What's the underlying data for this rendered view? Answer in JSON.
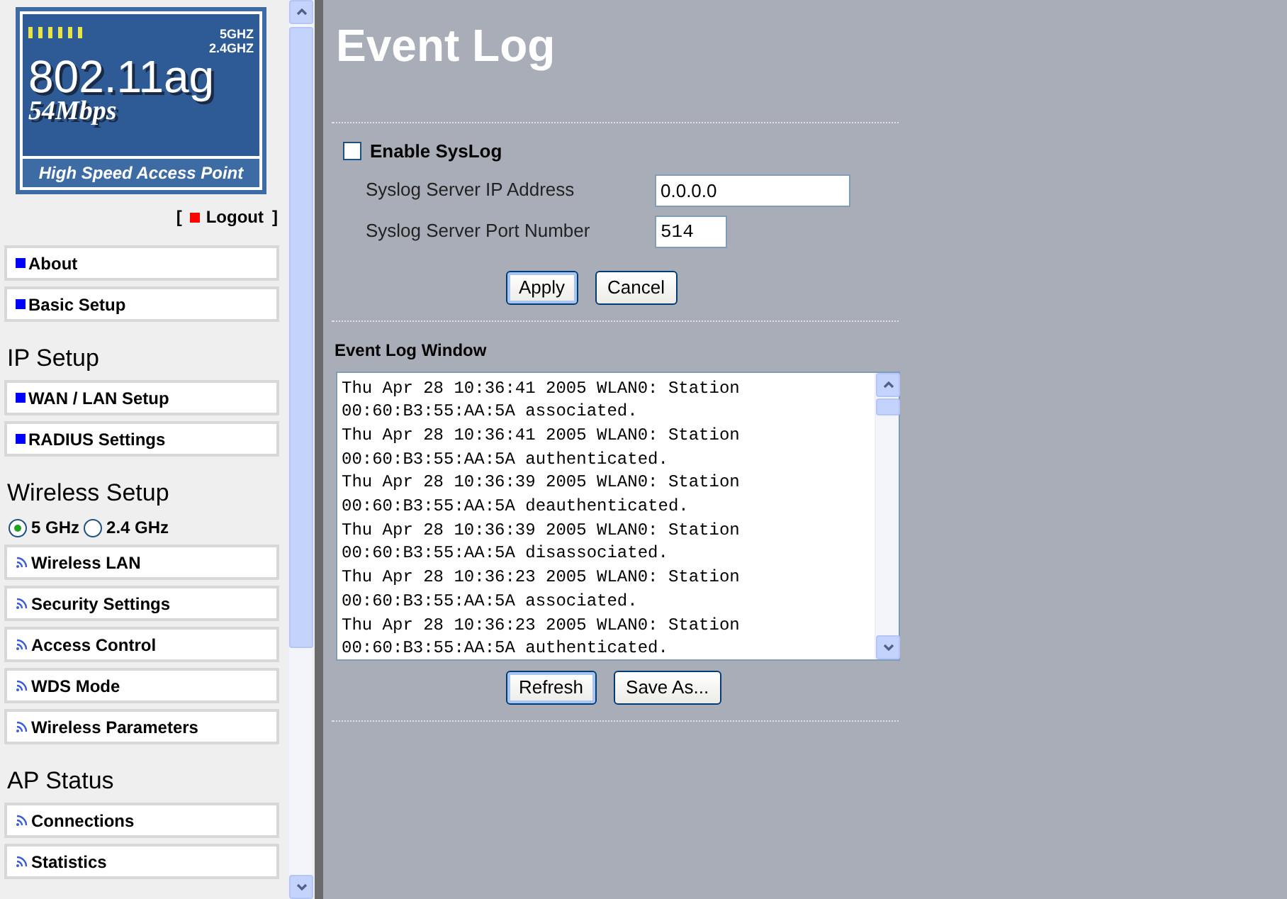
{
  "logo": {
    "bands": [
      "5GHZ",
      "2.4GHZ"
    ],
    "standard": "802.11ag",
    "speed": "54Mbps",
    "tagline": "High Speed Access Point"
  },
  "logout": {
    "open": "[",
    "label": "Logout",
    "close": "]"
  },
  "sidebar": {
    "sections": [
      {
        "items": [
          {
            "label": "About",
            "kind": "square"
          },
          {
            "label": "Basic Setup",
            "kind": "square"
          }
        ]
      },
      {
        "heading": "IP Setup",
        "items": [
          {
            "label": "WAN / LAN Setup",
            "kind": "square"
          },
          {
            "label": "RADIUS Settings",
            "kind": "square"
          }
        ]
      },
      {
        "heading": "Wireless Setup",
        "radios": [
          {
            "label": "5 GHz",
            "selected": true
          },
          {
            "label": "2.4 GHz",
            "selected": false
          }
        ],
        "items": [
          {
            "label": "Wireless LAN",
            "kind": "wifi"
          },
          {
            "label": "Security Settings",
            "kind": "wifi"
          },
          {
            "label": "Access Control",
            "kind": "wifi"
          },
          {
            "label": "WDS Mode",
            "kind": "wifi"
          },
          {
            "label": "Wireless Parameters",
            "kind": "wifi"
          }
        ]
      },
      {
        "heading": "AP Status",
        "items": [
          {
            "label": "Connections",
            "kind": "wifi"
          },
          {
            "label": "Statistics",
            "kind": "wifi"
          }
        ]
      }
    ]
  },
  "page_title": "Event Log",
  "syslog": {
    "enable": {
      "label": "Enable SysLog",
      "checked": false
    },
    "fields": [
      {
        "label": "Syslog Server IP Address",
        "value": "0.0.0.0",
        "kind": "wide"
      },
      {
        "label": "Syslog Server Port Number",
        "value": "514",
        "kind": "narrow"
      }
    ],
    "buttons": [
      {
        "label": "Apply",
        "focused": true
      },
      {
        "label": "Cancel",
        "focused": false
      }
    ]
  },
  "event_log": {
    "title": "Event Log Window",
    "lines": [
      "Thu Apr 28 10:36:41 2005 WLAN0: Station",
      "00:60:B3:55:AA:5A associated.",
      "Thu Apr 28 10:36:41 2005 WLAN0: Station",
      "00:60:B3:55:AA:5A authenticated.",
      "Thu Apr 28 10:36:39 2005 WLAN0: Station",
      "00:60:B3:55:AA:5A deauthenticated.",
      "Thu Apr 28 10:36:39 2005 WLAN0: Station",
      "00:60:B3:55:AA:5A disassociated.",
      "Thu Apr 28 10:36:23 2005 WLAN0: Station",
      "00:60:B3:55:AA:5A associated.",
      "Thu Apr 28 10:36:23 2005 WLAN0: Station",
      "00:60:B3:55:AA:5A authenticated."
    ],
    "buttons": [
      {
        "label": "Refresh",
        "focused": true
      },
      {
        "label": "Save As...",
        "focused": false
      }
    ]
  }
}
